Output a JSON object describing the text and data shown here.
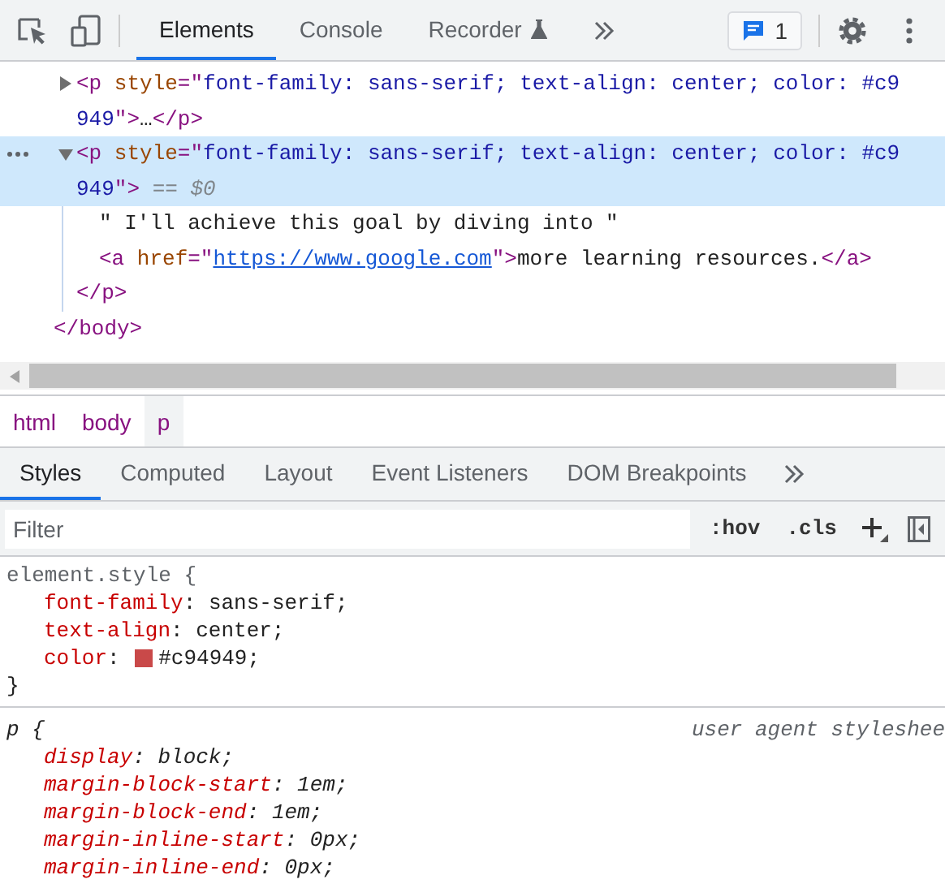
{
  "toolbar": {
    "tabs": [
      {
        "label": "Elements",
        "selected": true,
        "kind": "plain"
      },
      {
        "label": "Console",
        "selected": false,
        "kind": "plain"
      },
      {
        "label": "Recorder",
        "selected": false,
        "kind": "experimental"
      }
    ],
    "issues_count": "1"
  },
  "dom_tree": {
    "children": [
      {
        "kind": "element",
        "expanded": false,
        "selected": false,
        "lines": [
          [
            {
              "kind": "tag",
              "text": "<p"
            },
            {
              "kind": "attr",
              "text": " style"
            },
            {
              "kind": "tag",
              "text": "=\""
            },
            {
              "kind": "value",
              "text": "font-family: sans-serif; text-align: center; color: #c9"
            }
          ],
          [
            {
              "kind": "value",
              "text": "949"
            },
            {
              "kind": "tag",
              "text": "\">"
            },
            {
              "kind": "text",
              "text": "…"
            },
            {
              "kind": "tag",
              "text": "</p>"
            }
          ]
        ]
      },
      {
        "kind": "element",
        "expanded": true,
        "selected": true,
        "lines": [
          [
            {
              "kind": "tag",
              "text": "<p"
            },
            {
              "kind": "attr",
              "text": " style"
            },
            {
              "kind": "tag",
              "text": "=\""
            },
            {
              "kind": "value",
              "text": "font-family: sans-serif; text-align: center; color: #c9"
            }
          ],
          [
            {
              "kind": "value",
              "text": "949"
            },
            {
              "kind": "tag",
              "text": "\">"
            },
            {
              "kind": "hint",
              "text": " == $0"
            }
          ]
        ],
        "children": [
          {
            "lines": [
              [
                {
                  "kind": "text",
                  "text": "\" I'll achieve this goal by diving into \""
                }
              ]
            ]
          },
          {
            "lines": [
              [
                {
                  "kind": "tag",
                  "text": "<a"
                },
                {
                  "kind": "attr",
                  "text": " href"
                },
                {
                  "kind": "tag",
                  "text": "=\""
                },
                {
                  "kind": "link",
                  "text": "https://www.google.com"
                },
                {
                  "kind": "tag",
                  "text": "\">"
                },
                {
                  "kind": "text",
                  "text": "more learning resources."
                },
                {
                  "kind": "tag",
                  "text": "</a>"
                }
              ]
            ]
          }
        ],
        "closing": [
          {
            "kind": "tag",
            "text": "</p>"
          }
        ]
      }
    ],
    "closing": [
      {
        "kind": "tag",
        "text": "</body>"
      }
    ]
  },
  "breadcrumbs": [
    {
      "label": "html",
      "selected": false
    },
    {
      "label": "body",
      "selected": false
    },
    {
      "label": "p",
      "selected": true
    }
  ],
  "styles_tabs": [
    {
      "label": "Styles",
      "selected": true
    },
    {
      "label": "Computed",
      "selected": false
    },
    {
      "label": "Layout",
      "selected": false
    },
    {
      "label": "Event Listeners",
      "selected": false
    },
    {
      "label": "DOM Breakpoints",
      "selected": false
    }
  ],
  "filter": {
    "placeholder": "Filter"
  },
  "style_buttons": [
    ":hov",
    ".cls"
  ],
  "rules": [
    {
      "kind": "inline",
      "selector": "element.style",
      "open": "{",
      "close": "}",
      "separator": ":",
      "properties": [
        {
          "name": "font-family",
          "value": "sans-serif;"
        },
        {
          "name": "text-align",
          "value": "center;"
        },
        {
          "name": "color",
          "value": "#c94949;",
          "swatch": true
        }
      ]
    },
    {
      "kind": "user-agent",
      "selector": "p",
      "open": "{",
      "separator": ":",
      "origin": "user agent styleshee",
      "properties": [
        {
          "name": "display",
          "value": "block;"
        },
        {
          "name": "margin-block-start",
          "value": "1em;"
        },
        {
          "name": "margin-block-end",
          "value": "1em;"
        },
        {
          "name": "margin-inline-start",
          "value": "0px;"
        },
        {
          "name": "margin-inline-end",
          "value": "0px;"
        }
      ]
    }
  ]
}
